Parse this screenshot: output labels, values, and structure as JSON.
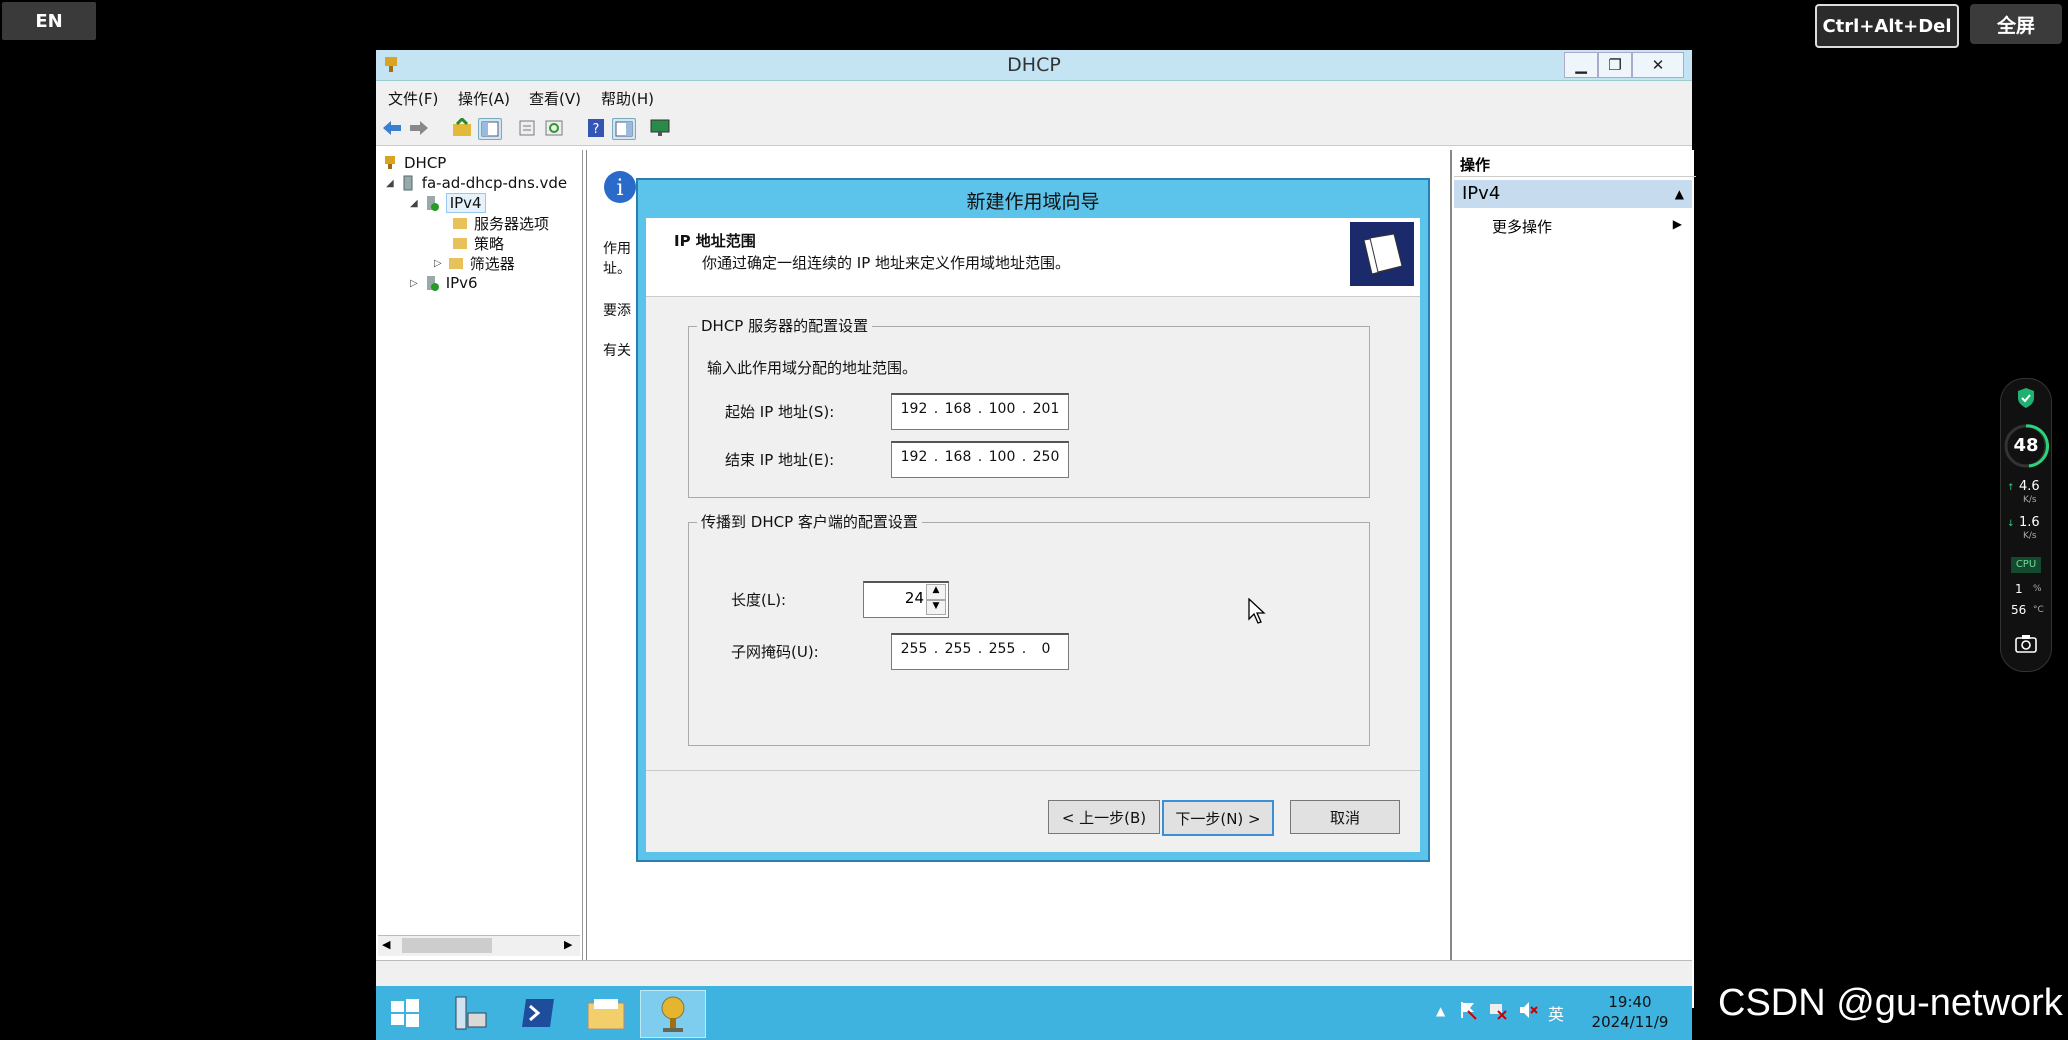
{
  "overlay": {
    "lang": "EN",
    "ctrl_alt_del": "Ctrl+Alt+Del",
    "fullscreen": "全屏"
  },
  "window": {
    "title": "DHCP",
    "controls": {
      "minimize": "▁",
      "restore": "❐",
      "close": "✕"
    },
    "menu": [
      "文件(F)",
      "操作(A)",
      "查看(V)",
      "帮助(H)"
    ]
  },
  "tree": {
    "root": "DHCP",
    "server": "fa-ad-dhcp-dns.vde",
    "ipv4": "IPv4",
    "children": [
      "服务器选项",
      "策略",
      "筛选器"
    ],
    "ipv6": "IPv6"
  },
  "main": {
    "fragments": [
      "作用",
      "址。",
      "要添",
      "有关"
    ]
  },
  "actions": {
    "header": "操作",
    "section": "IPv4",
    "more": "更多操作"
  },
  "dialog": {
    "title": "新建作用域向导",
    "header_title": "IP 地址范围",
    "header_desc": "你通过确定一组连续的 IP 地址来定义作用域地址范围。",
    "group1": {
      "label": "DHCP 服务器的配置设置",
      "instruction": "输入此作用域分配的地址范围。",
      "start_label": "起始 IP 地址(S):",
      "start_ip": [
        "192",
        "168",
        "100",
        "201"
      ],
      "end_label": "结束 IP 地址(E):",
      "end_ip": [
        "192",
        "168",
        "100",
        "250"
      ]
    },
    "group2": {
      "label": "传播到 DHCP 客户端的配置设置",
      "length_label": "长度(L):",
      "length": "24",
      "mask_label": "子网掩码(U):",
      "mask": [
        "255",
        "255",
        "255",
        "0"
      ]
    },
    "buttons": {
      "back": "< 上一步(B)",
      "next": "下一步(N) >",
      "cancel": "取消"
    }
  },
  "taskbar": {
    "time": "19:40",
    "date": "2024/11/9",
    "ime": "英"
  },
  "monitor": {
    "percent": "48",
    "up": "4.6",
    "up_unit": "K/s",
    "down": "1.6",
    "down_unit": "K/s",
    "cpu_label": "CPU",
    "cpu": "1",
    "cpu_unit": "%",
    "temp": "56",
    "temp_unit": "°C"
  },
  "watermark": "CSDN @gu-network"
}
